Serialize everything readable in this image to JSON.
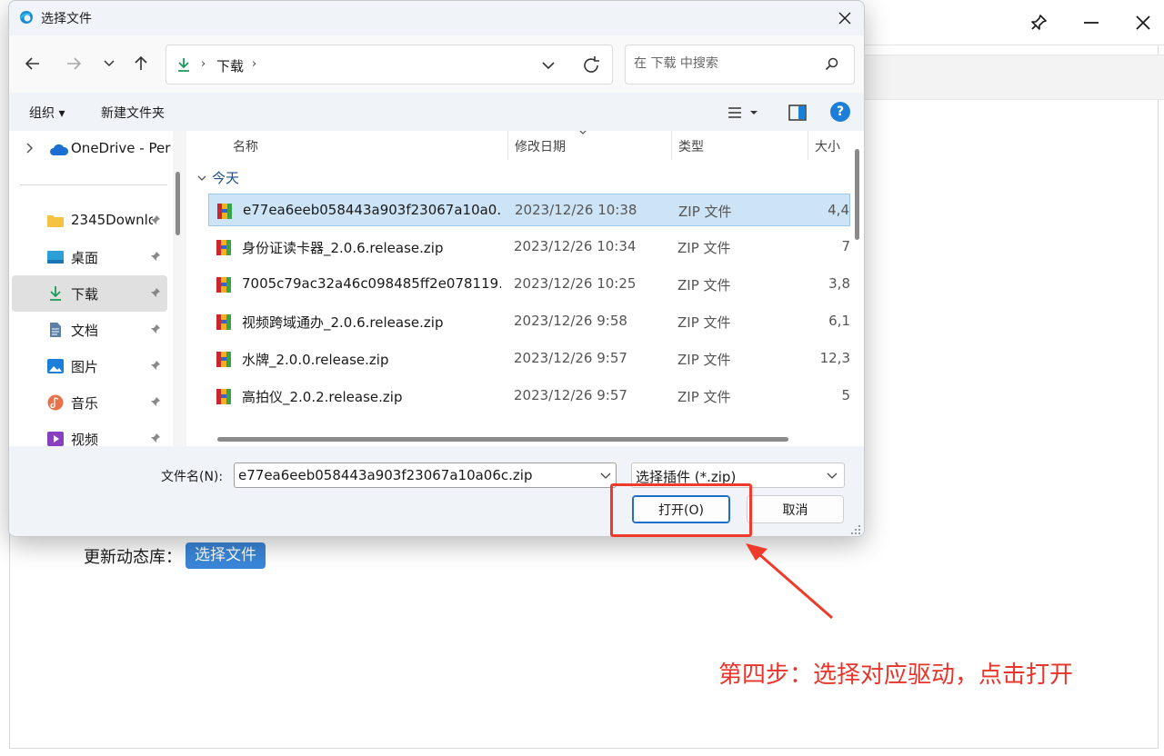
{
  "dialog": {
    "title": "选择文件",
    "address": {
      "location": "下载",
      "separator": "›"
    },
    "search": {
      "placeholder": "在 下载 中搜索"
    },
    "commands": {
      "organize": "组织 ▾",
      "new_folder": "新建文件夹",
      "help": "?"
    },
    "nav_pane": {
      "onedrive": "OneDrive - Per",
      "items": [
        {
          "label": "2345Downlo",
          "icon": "folder-icon"
        },
        {
          "label": "桌面",
          "icon": "desktop-icon"
        },
        {
          "label": "下载",
          "icon": "download-icon",
          "selected": true
        },
        {
          "label": "文档",
          "icon": "document-icon"
        },
        {
          "label": "图片",
          "icon": "pictures-icon"
        },
        {
          "label": "音乐",
          "icon": "music-icon"
        },
        {
          "label": "视频",
          "icon": "video-icon"
        }
      ]
    },
    "columns": {
      "name": "名称",
      "modified": "修改日期",
      "type": "类型",
      "size": "大小"
    },
    "group": "今天",
    "files": [
      {
        "name": "e77ea6eeb058443a903f23067a10a0...",
        "date": "2023/12/26 10:38",
        "type": "ZIP 文件",
        "size": "4,4",
        "selected": true
      },
      {
        "name": "身份证读卡器_2.0.6.release.zip",
        "date": "2023/12/26 10:34",
        "type": "ZIP 文件",
        "size": "7"
      },
      {
        "name": "7005c79ac32a46c098485ff2e078119...",
        "date": "2023/12/26 10:25",
        "type": "ZIP 文件",
        "size": "3,8"
      },
      {
        "name": "视频跨域通办_2.0.6.release.zip",
        "date": "2023/12/26 9:58",
        "type": "ZIP 文件",
        "size": "6,1"
      },
      {
        "name": "水牌_2.0.0.release.zip",
        "date": "2023/12/26 9:57",
        "type": "ZIP 文件",
        "size": "12,3"
      },
      {
        "name": "高拍仪_2.0.2.release.zip",
        "date": "2023/12/26 9:57",
        "type": "ZIP 文件",
        "size": "5"
      }
    ],
    "filename_label": "文件名(N):",
    "filename_value": "e77ea6eeb058443a903f23067a10a06c.zip",
    "filter_value": "选择插件 (*.zip)",
    "open_label": "打开(O)",
    "cancel_label": "取消"
  },
  "background": {
    "row_label": "更新动态库：",
    "choose_button": "选择文件"
  },
  "annotation": {
    "text": "第四步：选择对应驱动，点击打开",
    "color": "#e8352a"
  }
}
